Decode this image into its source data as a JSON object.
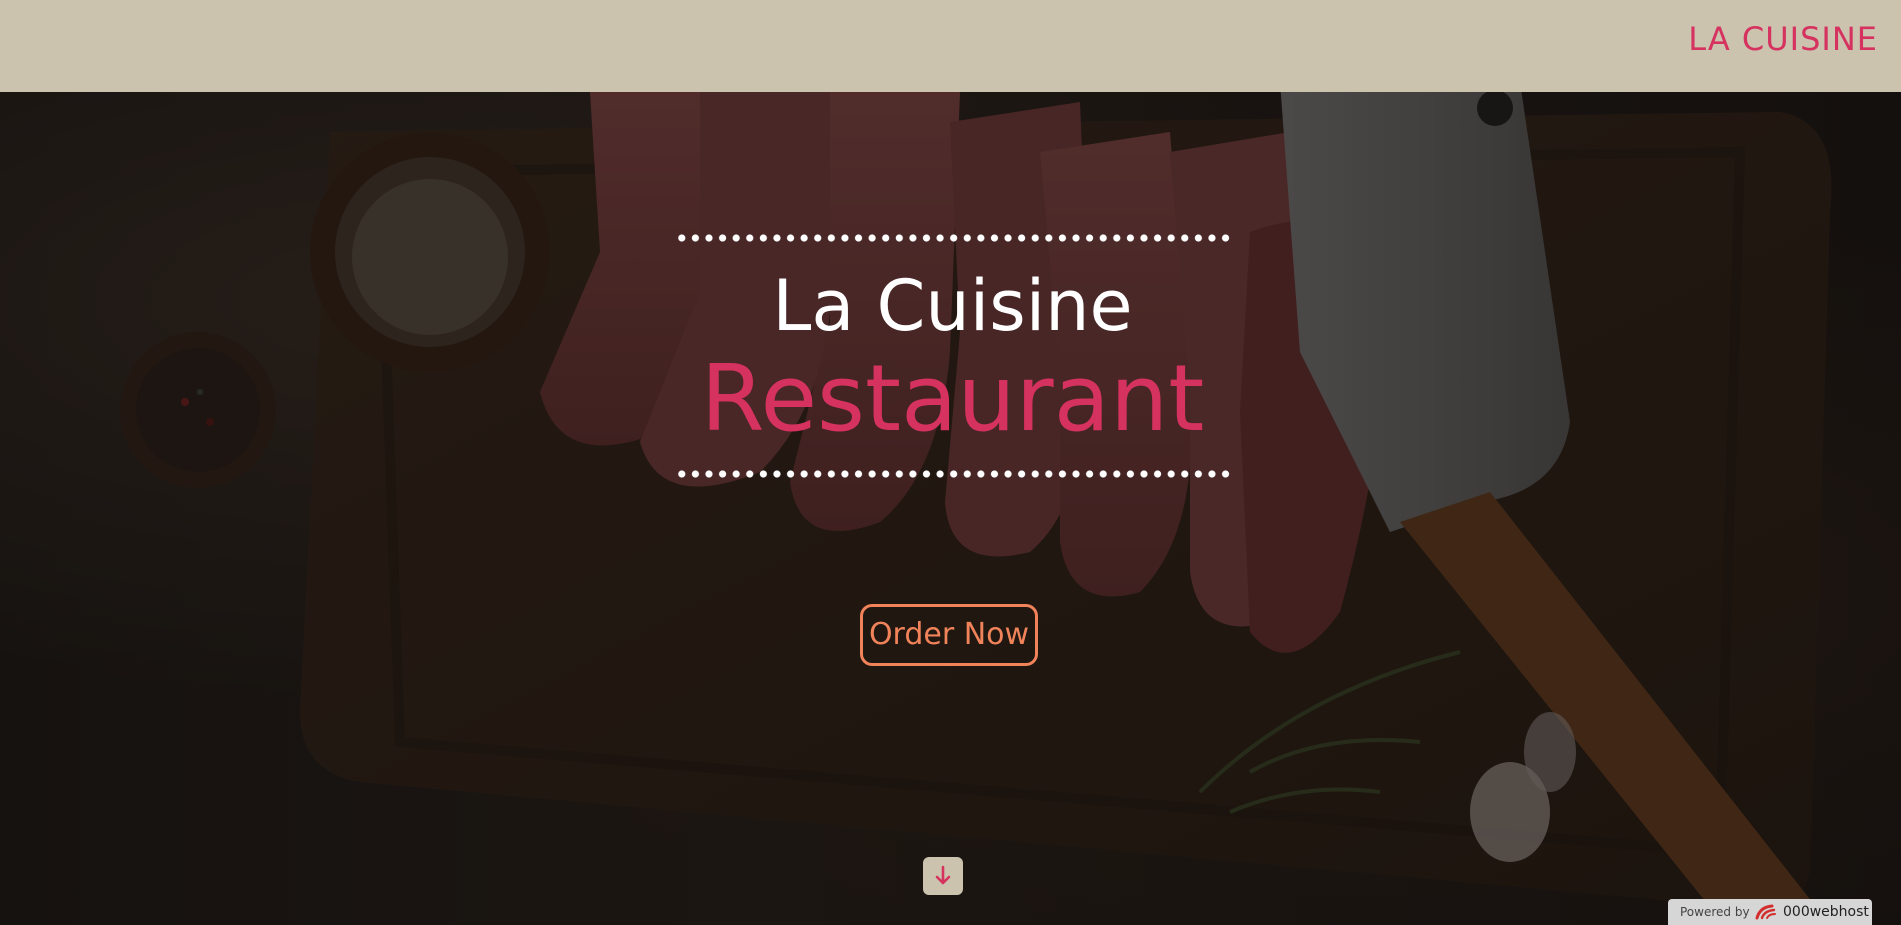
{
  "header": {
    "brand": "LA CUISINE"
  },
  "hero": {
    "title_line1": "La Cuisine",
    "title_line2": "Restaurant",
    "cta_label": "Order Now",
    "scroll_icon": "arrow-down-icon"
  },
  "footer_badge": {
    "prefix": "Powered by",
    "host": "000webhost",
    "logo_icon": "000webhost-logo-icon"
  },
  "colors": {
    "header_bg": "#cbc3ae",
    "brand": "#d6325f",
    "title_white": "#ffffff",
    "title_pink": "#d6325f",
    "cta_orange": "#f0835a"
  }
}
